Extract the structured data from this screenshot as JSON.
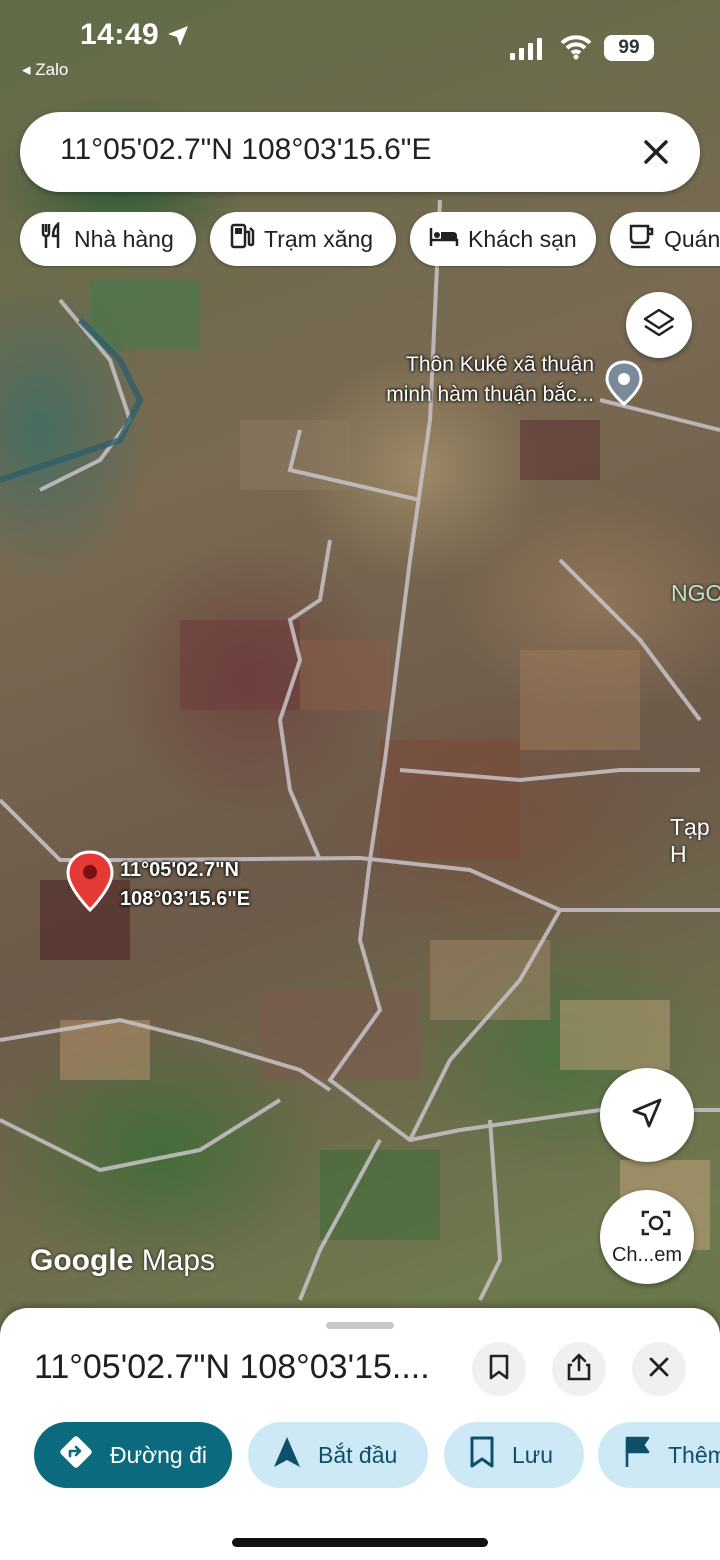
{
  "status_bar": {
    "time": "14:49",
    "back_app": "◂ Zalo",
    "battery": "99",
    "icons": [
      "location-arrow-icon",
      "signal-bars-icon",
      "wifi-icon",
      "battery-icon"
    ]
  },
  "search": {
    "query": "11°05'02.7\"N 108°03'15.6\"E"
  },
  "categories": [
    {
      "label": "Nhà hàng",
      "icon": "restaurant-icon"
    },
    {
      "label": "Trạm xăng",
      "icon": "gas-station-icon"
    },
    {
      "label": "Khách sạn",
      "icon": "hotel-icon"
    },
    {
      "label": "Quán",
      "icon": "coffee-icon"
    }
  ],
  "map": {
    "place_name_line1": "Thôn Kukê xã thuận",
    "place_name_line2": "minh hàm thuận bắc...",
    "area_label_ngo": "NGO",
    "area_label_tap": "Tạp H",
    "pin_lat": "11°05'02.7\"N",
    "pin_lng": "108°03'15.6\"E",
    "logo_google": "Google",
    "logo_maps": "Maps"
  },
  "camera_button": {
    "label": "Ch...em"
  },
  "sheet": {
    "title": "11°05'02.7\"N 108°03'15....",
    "actions": [
      {
        "label": "Đường đi",
        "icon": "directions-icon"
      },
      {
        "label": "Bắt đầu",
        "icon": "navigation-arrow-icon"
      },
      {
        "label": "Lưu",
        "icon": "bookmark-icon"
      },
      {
        "label": "Thêm",
        "icon": "flag-icon"
      }
    ]
  },
  "colors": {
    "primary_action": "#0b6a7e",
    "secondary_action": "#cde9f5",
    "pin_red": "#e53935"
  }
}
